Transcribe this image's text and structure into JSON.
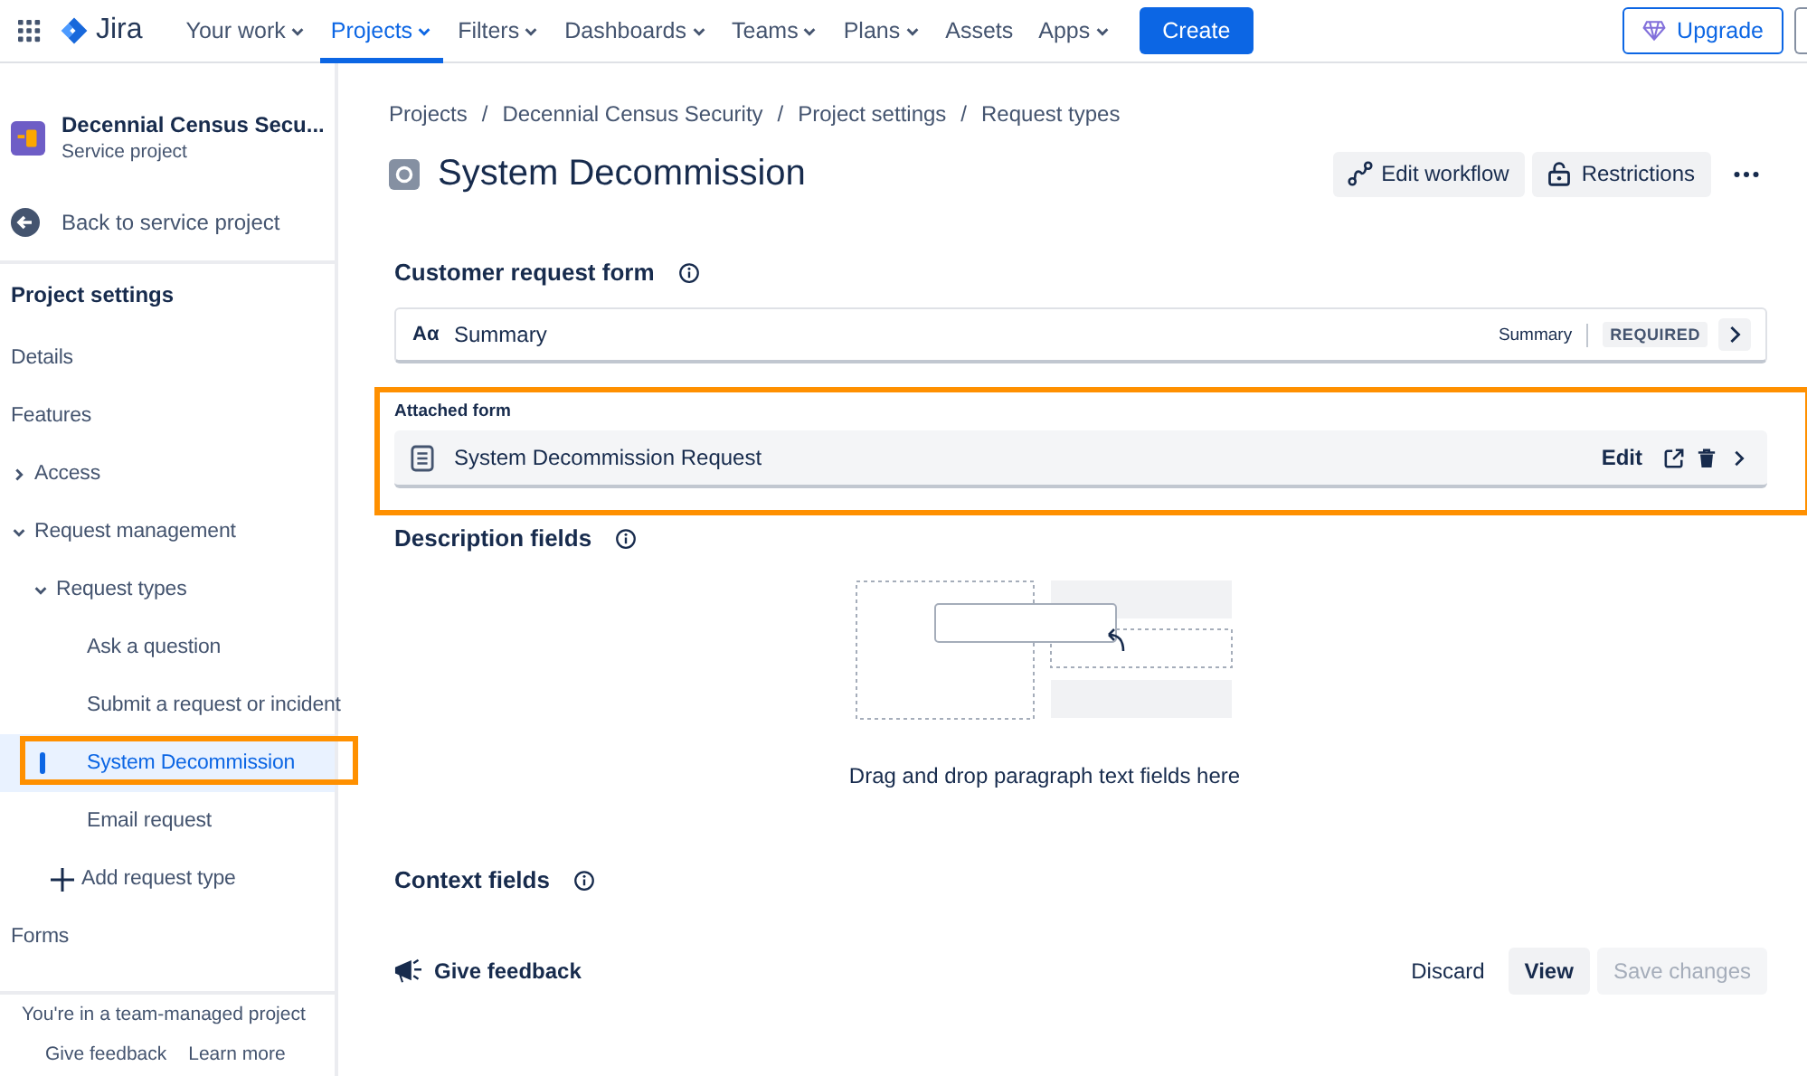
{
  "topnav": {
    "product": "Jira",
    "items": [
      {
        "label": "Your work",
        "dropdown": true,
        "selected": false
      },
      {
        "label": "Projects",
        "dropdown": true,
        "selected": true
      },
      {
        "label": "Filters",
        "dropdown": true,
        "selected": false
      },
      {
        "label": "Dashboards",
        "dropdown": true,
        "selected": false
      },
      {
        "label": "Teams",
        "dropdown": true,
        "selected": false
      },
      {
        "label": "Plans",
        "dropdown": true,
        "selected": false
      },
      {
        "label": "Assets",
        "dropdown": false,
        "selected": false
      },
      {
        "label": "Apps",
        "dropdown": true,
        "selected": false
      }
    ],
    "create": "Create",
    "upgrade": "Upgrade"
  },
  "sidebar": {
    "project_name": "Decennial Census Secu...",
    "project_type": "Service project",
    "back": "Back to service project",
    "heading": "Project settings",
    "items": [
      {
        "label": "Details",
        "kind": "link",
        "selected": false
      },
      {
        "label": "Features",
        "kind": "link",
        "selected": false
      },
      {
        "label": "Access",
        "kind": "group",
        "expanded": false,
        "selected": false
      },
      {
        "label": "Request management",
        "kind": "group",
        "expanded": true,
        "selected": false,
        "children": [
          {
            "label": "Request types",
            "kind": "group",
            "expanded": true,
            "selected": false,
            "children": [
              {
                "label": "Ask a question",
                "kind": "link",
                "selected": false
              },
              {
                "label": "Submit a request or incident",
                "kind": "link",
                "selected": false
              },
              {
                "label": "System Decommission",
                "kind": "link",
                "selected": true,
                "highlighted": true
              },
              {
                "label": "Email request",
                "kind": "link",
                "selected": false
              },
              {
                "label": "Add request type",
                "kind": "add",
                "selected": false
              }
            ]
          }
        ]
      },
      {
        "label": "Forms",
        "kind": "link",
        "selected": false
      }
    ],
    "footer": {
      "note": "You're in a team-managed project",
      "links": [
        "Give feedback",
        "Learn more"
      ]
    }
  },
  "breadcrumbs": [
    "Projects",
    "Decennial Census Security",
    "Project settings",
    "Request types"
  ],
  "breadcrumb_separator": "/",
  "page_title": "System Decommission",
  "actions": [
    "Edit workflow",
    "Restrictions"
  ],
  "customer_request_form": {
    "heading": "Customer request form",
    "fields": [
      {
        "icon_text": "Aα",
        "name": "Summary",
        "display_name": "Summary",
        "badge": "REQUIRED"
      }
    ]
  },
  "attached_form": {
    "label": "Attached form",
    "name": "System Decommission Request",
    "edit": "Edit",
    "highlighted": true
  },
  "description_fields": {
    "heading": "Description fields",
    "empty_text": "Drag and drop paragraph text fields here"
  },
  "context_fields": {
    "heading": "Context fields"
  },
  "footer_bar": {
    "feedback": "Give feedback",
    "buttons": [
      {
        "label": "Discard",
        "kind": "subtle",
        "disabled": false
      },
      {
        "label": "View",
        "kind": "default",
        "disabled": false
      },
      {
        "label": "Save changes",
        "kind": "primary",
        "disabled": true
      }
    ]
  }
}
